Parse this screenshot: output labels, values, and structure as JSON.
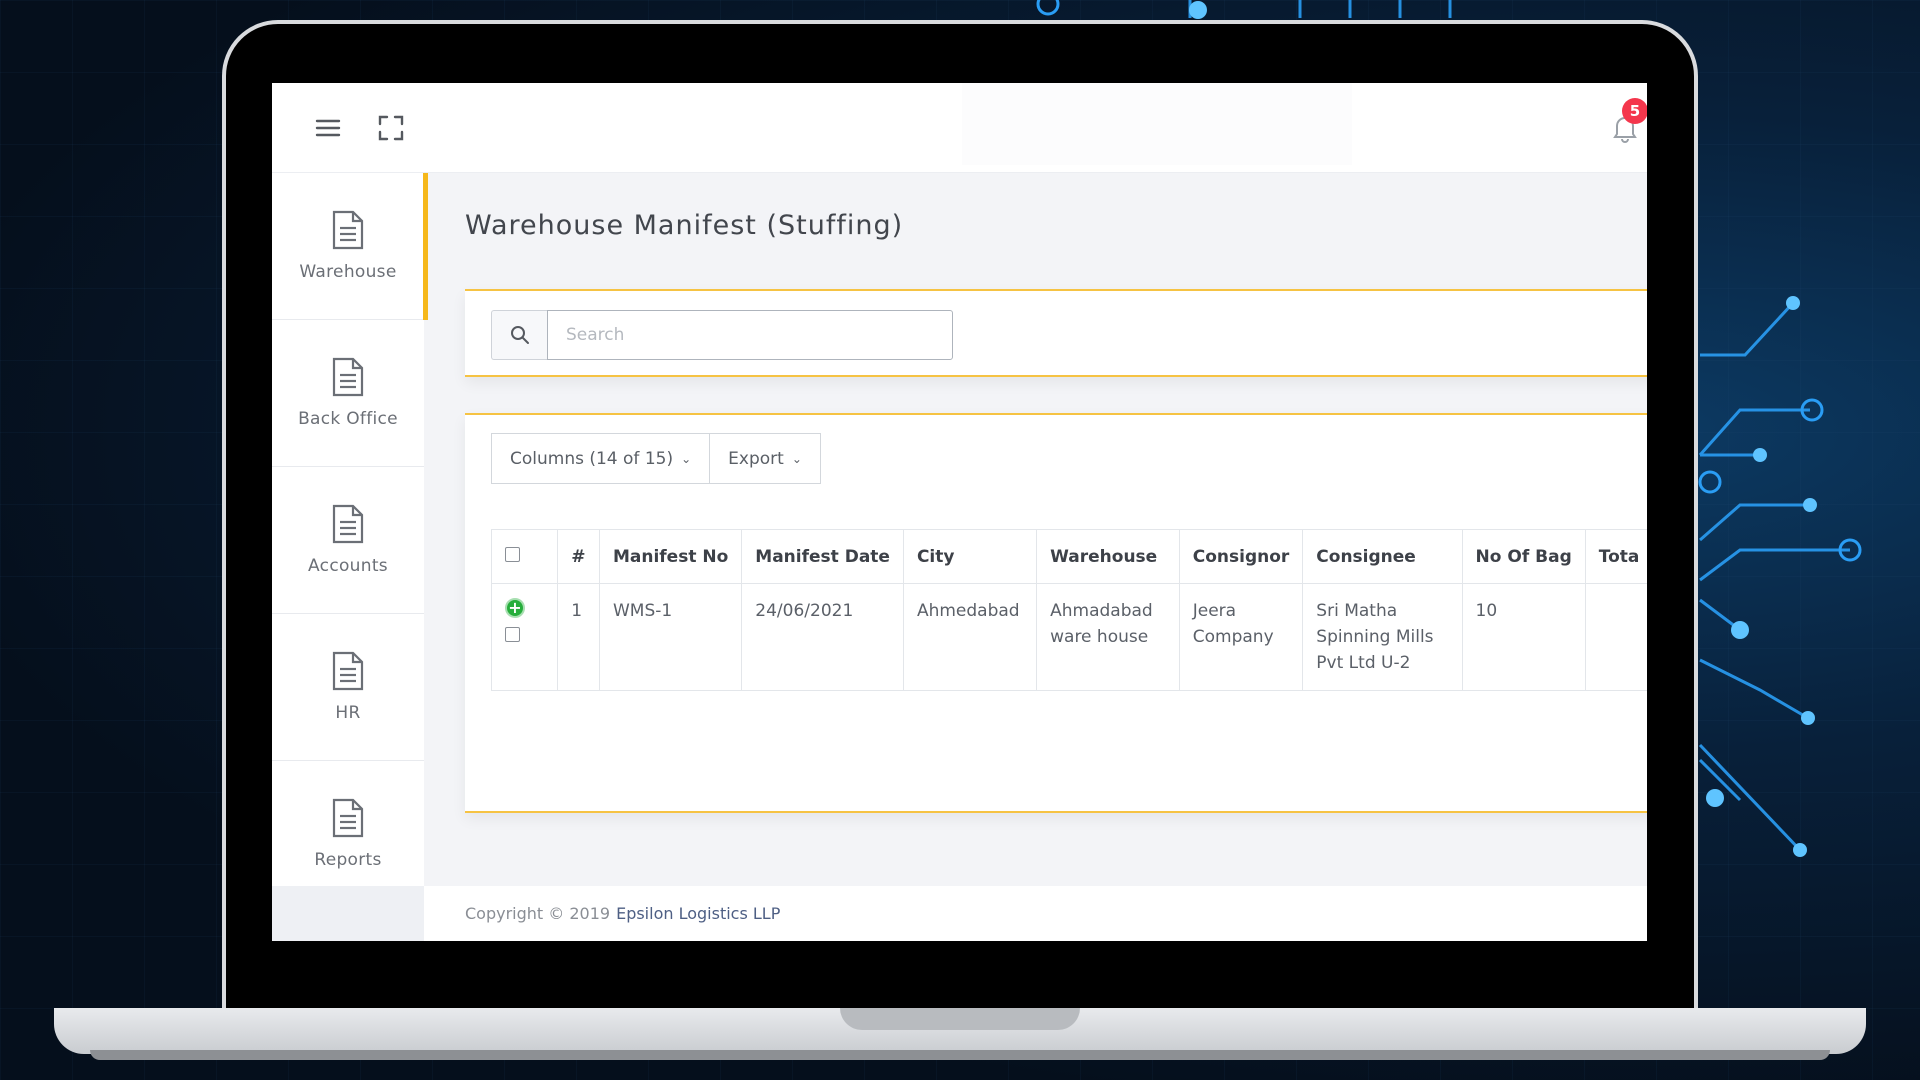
{
  "topbar": {
    "menu_icon": "hamburger-icon",
    "fullscreen_icon": "expand-icon",
    "notification_count": "5"
  },
  "sidebar": {
    "items": [
      {
        "label": "Warehouse",
        "icon": "document-icon",
        "active": true
      },
      {
        "label": "Back Office",
        "icon": "document-icon"
      },
      {
        "label": "Accounts",
        "icon": "document-icon"
      },
      {
        "label": "HR",
        "icon": "document-icon"
      },
      {
        "label": "Reports",
        "icon": "document-icon"
      }
    ]
  },
  "page": {
    "title": "Warehouse Manifest (Stuffing)"
  },
  "search": {
    "placeholder": "Search",
    "value": ""
  },
  "toolbar": {
    "columns_label": "Columns (14 of 15)",
    "export_label": "Export"
  },
  "table": {
    "headers": [
      "#",
      "Manifest No",
      "Manifest Date",
      "City",
      "Warehouse",
      "Consignor",
      "Consignee",
      "No Of Bag",
      "Tota"
    ],
    "rows": [
      {
        "index": "1",
        "manifest_no": "WMS-1",
        "manifest_date": "24/06/2021",
        "city": "Ahmedabad",
        "warehouse": "Ahmadabad ware house",
        "consignor": "Jeera Company",
        "consignee": "Sri Matha Spinning Mills Pvt Ltd U-2",
        "no_of_bag": "10",
        "total": ""
      }
    ]
  },
  "footer": {
    "copyright": "Copyright © 2019",
    "company": "Epsilon Logistics LLP"
  },
  "colors": {
    "accent": "#f6b81b",
    "badge": "#f4364c",
    "expand_button": "#27ae3c"
  }
}
